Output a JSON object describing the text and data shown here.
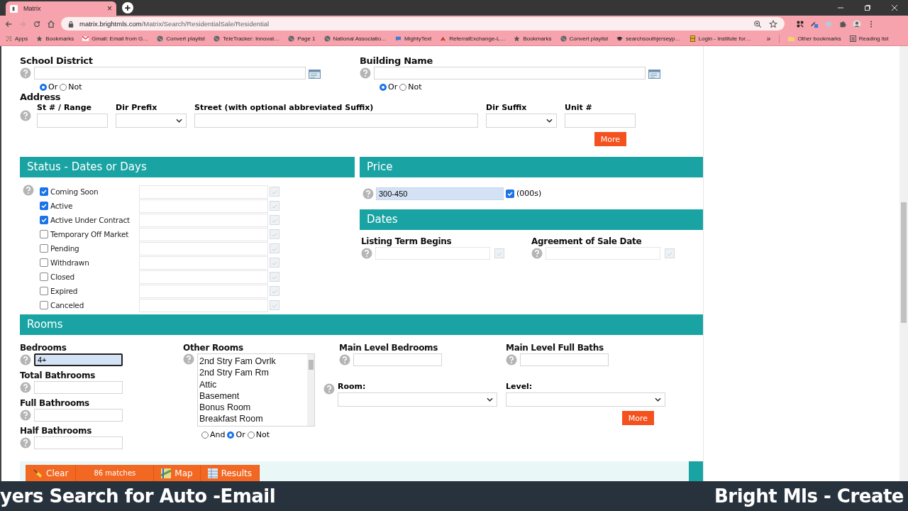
{
  "browser": {
    "tab": {
      "title": "Matrix",
      "close": "×"
    },
    "new_tab": "+",
    "url": {
      "host": "matrix.brightmls.com",
      "path": "/Matrix/Search/ResidentialSale/Residential"
    },
    "bookmarks": [
      {
        "label": "Apps",
        "kind": "apps"
      },
      {
        "label": "Bookmarks",
        "kind": "star"
      },
      {
        "label": "Gmail: Email from G…",
        "kind": "mail"
      },
      {
        "label": "Convert playlist",
        "kind": "globe"
      },
      {
        "label": "TeleTracker: Innovat…",
        "kind": "globe"
      },
      {
        "label": "Page 1",
        "kind": "globe"
      },
      {
        "label": "National Associatio…",
        "kind": "globe"
      },
      {
        "label": "MightyText",
        "kind": "bubble"
      },
      {
        "label": "ReferralExchange-L…",
        "kind": "arrow"
      },
      {
        "label": "Bookmarks",
        "kind": "star"
      },
      {
        "label": "Convert playlist",
        "kind": "globe"
      },
      {
        "label": "searchsouthjerseyp…",
        "kind": "cap"
      },
      {
        "label": "Login - Institute for…",
        "kind": "calc"
      }
    ],
    "bookmarks_more": "»",
    "bookmarks_right": [
      {
        "label": "Other bookmarks",
        "kind": "folder"
      },
      {
        "label": "Reading list",
        "kind": "list"
      }
    ]
  },
  "lookups": [
    {
      "label": "School District",
      "modes": [
        {
          "label": "Or",
          "selected": true
        },
        {
          "label": "Not",
          "selected": false
        }
      ]
    },
    {
      "label": "Building Name",
      "modes": [
        {
          "label": "Or",
          "selected": true
        },
        {
          "label": "Not",
          "selected": false
        }
      ]
    }
  ],
  "address": {
    "label": "Address",
    "fields": [
      {
        "label": "St # / Range",
        "kind": "input"
      },
      {
        "label": "Dir Prefix",
        "kind": "select"
      },
      {
        "label": "Street (with optional abbreviated Suffix)",
        "kind": "wide"
      },
      {
        "label": "Dir Suffix",
        "kind": "select"
      },
      {
        "label": "Unit #",
        "kind": "input"
      }
    ]
  },
  "address_more": "More",
  "status": {
    "title": "Status - Dates or Days",
    "items": [
      {
        "label": "Coming Soon",
        "checked": true
      },
      {
        "label": "Active",
        "checked": true
      },
      {
        "label": "Active Under Contract",
        "checked": true
      },
      {
        "label": "Temporary Off Market",
        "checked": false
      },
      {
        "label": "Pending",
        "checked": false
      },
      {
        "label": "Withdrawn",
        "checked": false
      },
      {
        "label": "Closed",
        "checked": false
      },
      {
        "label": "Expired",
        "checked": false
      },
      {
        "label": "Canceled",
        "checked": false
      }
    ]
  },
  "price": {
    "title": "Price",
    "value": "300-450",
    "unit_checked": true,
    "unit_label": "(000s)"
  },
  "dates": {
    "title": "Dates",
    "fields": [
      "Listing Term Begins",
      "Agreement of Sale Date"
    ]
  },
  "rooms": {
    "title": "Rooms",
    "counts": [
      {
        "label": "Bedrooms",
        "value": "4+",
        "focused": true
      },
      {
        "label": "Total Bathrooms",
        "focused": false
      },
      {
        "label": "Full Bathrooms",
        "focused": false
      },
      {
        "label": "Half Bathrooms",
        "focused": false
      }
    ],
    "other_rooms": {
      "label": "Other Rooms",
      "options": [
        "2nd Stry Fam Ovrlk",
        "2nd Stry Fam Rm",
        "Attic",
        "Basement",
        "Bonus Room",
        "Breakfast Room"
      ],
      "modes": [
        {
          "label": "And",
          "selected": false
        },
        {
          "label": "Or",
          "selected": true
        },
        {
          "label": "Not",
          "selected": false
        }
      ]
    },
    "main_level": [
      "Main Level Bedrooms",
      "Main Level Full Baths"
    ],
    "pickers": [
      "Room:",
      "Level:"
    ],
    "more": "More"
  },
  "actions": [
    {
      "label": "Clear",
      "kind": "clear"
    },
    {
      "label": "86 matches",
      "kind": "count"
    },
    {
      "label": "Map",
      "kind": "map"
    },
    {
      "label": "Results",
      "kind": "results"
    }
  ],
  "caption": {
    "left": "yers Search for Auto -Email",
    "right": "Bright Mls - Create"
  }
}
